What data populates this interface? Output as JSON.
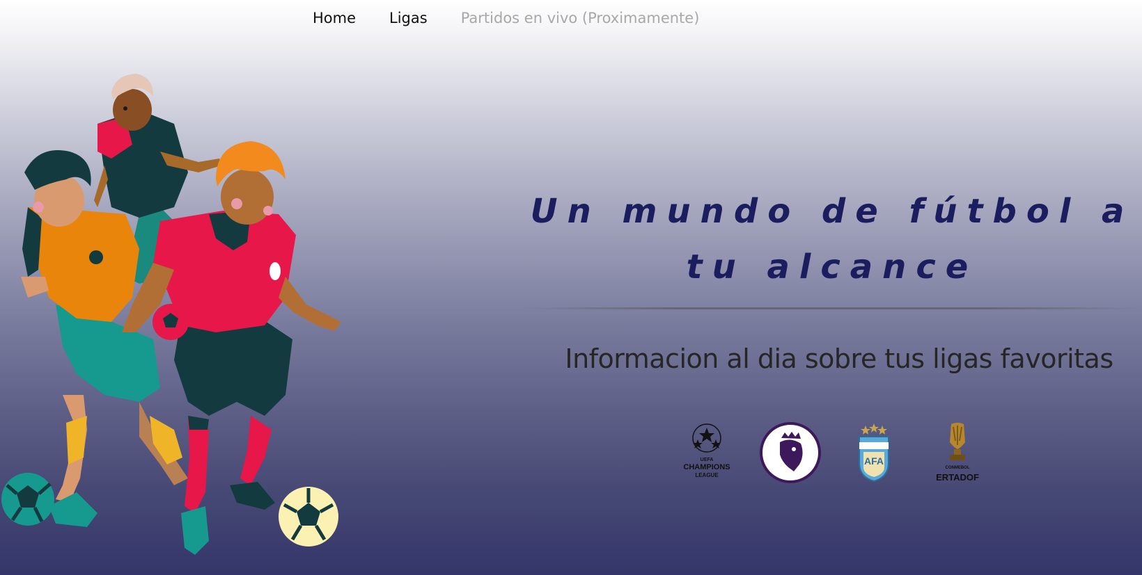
{
  "nav": {
    "items": [
      {
        "label": "Home",
        "enabled": true
      },
      {
        "label": "Ligas",
        "enabled": true
      },
      {
        "label": "Partidos en vivo (Proximamente)",
        "enabled": false
      }
    ]
  },
  "hero": {
    "title": "Un mundo de fútbol a tu alcance",
    "subtitle": "Informacion al dia sobre tus ligas favoritas"
  },
  "leagues": [
    {
      "name": "UEFA Champions League",
      "lines": [
        "UEFA",
        "CHAMPIONS",
        "LEAGUE"
      ],
      "icon": "champions-league-icon"
    },
    {
      "name": "Premier League",
      "text": "Premier League",
      "icon": "premier-league-icon"
    },
    {
      "name": "AFA",
      "text": "AFA",
      "icon": "afa-shield-icon"
    },
    {
      "name": "Copa Libertadores",
      "lines": [
        "CONMEBOL",
        "ERTADOF"
      ],
      "icon": "libertadores-trophy-icon"
    }
  ],
  "colors": {
    "title": "#1c1d5e",
    "subtitle": "#262626",
    "nav_active": "#111111",
    "nav_disabled": "#a8a8a8",
    "gradient_top": "#ffffff",
    "gradient_bottom": "#34356a",
    "player_red": "#e8174a",
    "player_orange": "#e8850a",
    "player_teal": "#16998f",
    "player_dark": "#123a3f"
  }
}
